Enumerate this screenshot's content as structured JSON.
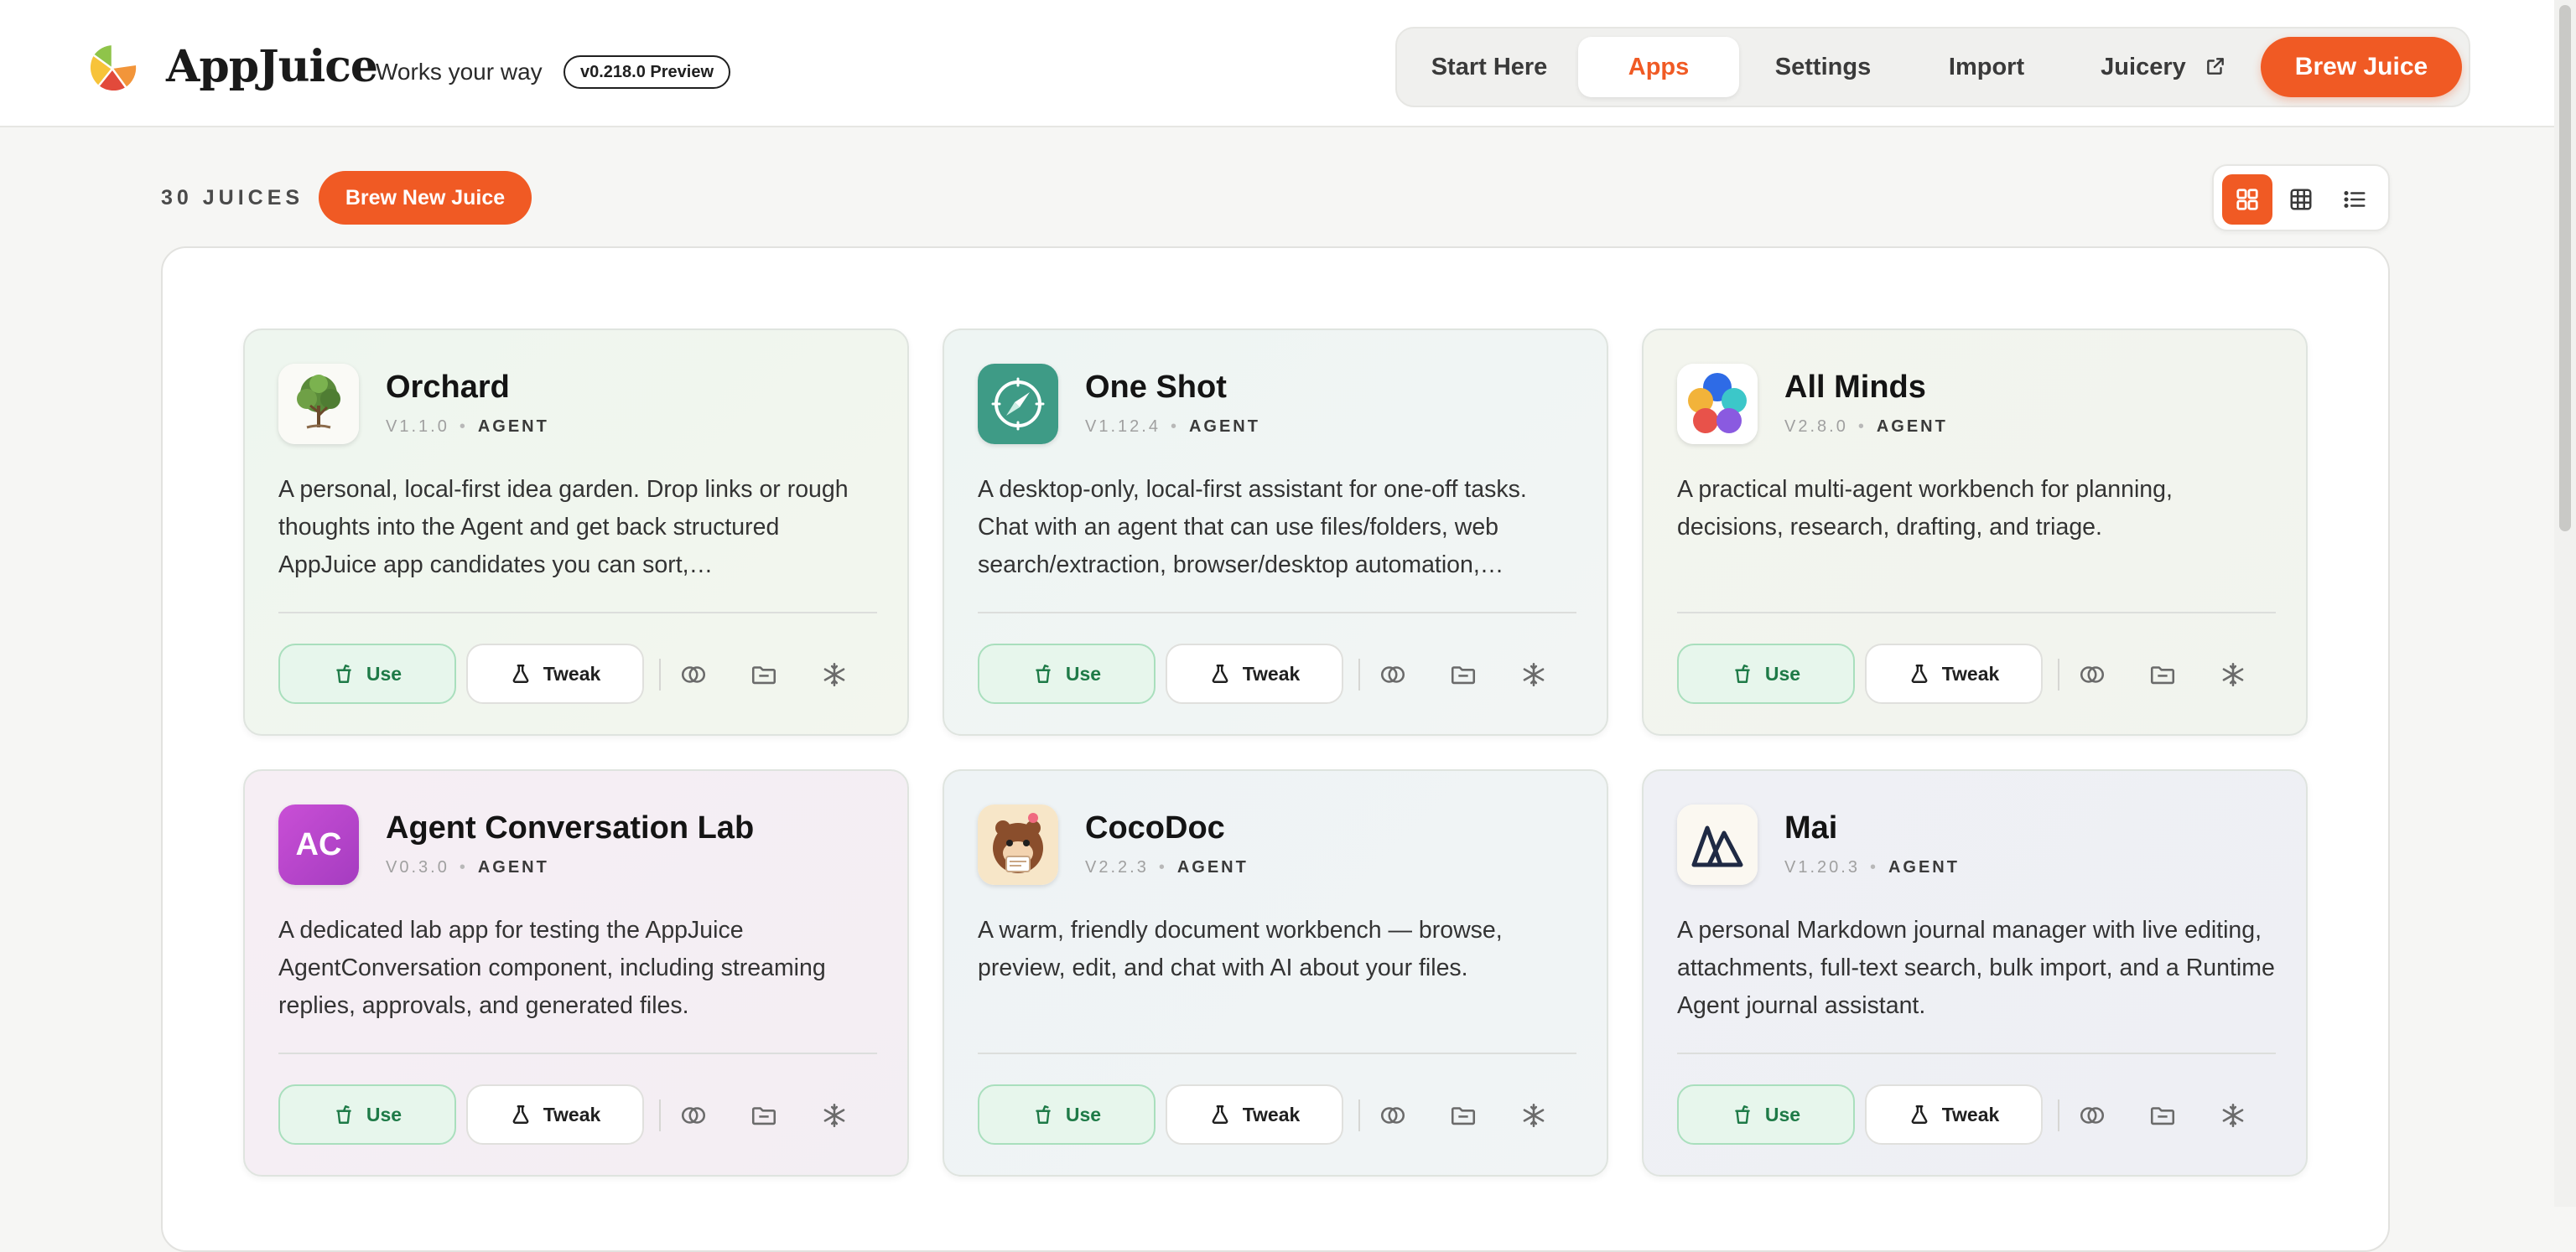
{
  "header": {
    "brand": "AppJuice",
    "tagline": "Works your way",
    "version": "v0.218.0 Preview"
  },
  "nav": {
    "items": [
      {
        "label": "Start Here",
        "active": false
      },
      {
        "label": "Apps",
        "active": true
      },
      {
        "label": "Settings",
        "active": false
      },
      {
        "label": "Import",
        "active": false
      },
      {
        "label": "Juicery",
        "active": false,
        "icon": "external-link-icon"
      }
    ],
    "brew_label": "Brew Juice"
  },
  "toolbar": {
    "count_label": "30 JUICES",
    "new_label": "Brew New Juice",
    "views": [
      "large-grid-icon",
      "grid-icon",
      "list-icon"
    ],
    "active_view": "large-grid-icon"
  },
  "colors": {
    "accent": "#f05a24",
    "use_green": "#1e7a47",
    "use_bg": "#e7f6ec"
  },
  "cards": [
    {
      "name": "Orchard",
      "version": "V1.1.0",
      "kind": "AGENT",
      "icon": "tree-icon",
      "description": "A personal, local-first idea garden. Drop links or rough thoughts into the Agent and get back structured AppJuice app candidates you can sort,…",
      "use_label": "Use",
      "tweak_label": "Tweak"
    },
    {
      "name": "One Shot",
      "version": "V1.12.4",
      "kind": "AGENT",
      "icon": "compass-icon",
      "description": "A desktop-only, local-first assistant for one-off tasks. Chat with an agent that can use files/folders, web search/extraction, browser/desktop automation,…",
      "use_label": "Use",
      "tweak_label": "Tweak"
    },
    {
      "name": "All Minds",
      "version": "V2.8.0",
      "kind": "AGENT",
      "icon": "colorful-petals-icon",
      "description": "A practical multi-agent workbench for planning, decisions, research, drafting, and triage.",
      "use_label": "Use",
      "tweak_label": "Tweak"
    },
    {
      "name": "Agent Conversation Lab",
      "version": "V0.3.0",
      "kind": "AGENT",
      "icon": "ac-monogram-icon",
      "icon_text": "AC",
      "description": "A dedicated lab app for testing the AppJuice AgentConversation component, including streaming replies, approvals, and generated files.",
      "use_label": "Use",
      "tweak_label": "Tweak"
    },
    {
      "name": "CocoDoc",
      "version": "V2.2.3",
      "kind": "AGENT",
      "icon": "coconut-mascot-icon",
      "description": "A warm, friendly document workbench — browse, preview, edit, and chat with AI about your files.",
      "use_label": "Use",
      "tweak_label": "Tweak"
    },
    {
      "name": "Mai",
      "version": "V1.20.3",
      "kind": "AGENT",
      "icon": "mountain-icon",
      "description": "A personal Markdown journal manager with live editing, attachments, full-text search, bulk import, and a Runtime Agent journal assistant.",
      "use_label": "Use",
      "tweak_label": "Tweak"
    }
  ]
}
